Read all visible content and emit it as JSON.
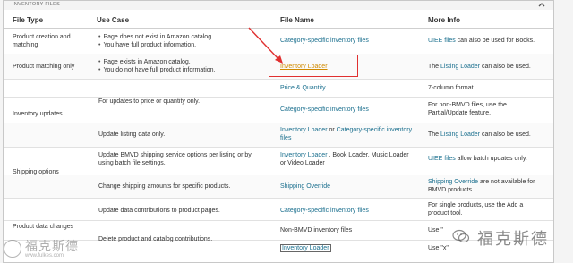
{
  "panel": {
    "title": "INVENTORY FILES"
  },
  "columns": {
    "file_type": "File Type",
    "use_case": "Use Case",
    "file_name": "File Name",
    "more_info": "More Info"
  },
  "rows": {
    "r1": {
      "file_type_1": "Product creation and",
      "file_type_2": "matching",
      "use_case_1": "Page does not exist in Amazon catalog.",
      "use_case_2": "You have full product information.",
      "file_name": "Category-specific inventory files",
      "more_info_link": "UIEE files",
      "more_info_text": " can also be used for Books."
    },
    "r2": {
      "file_type": "Product matching only",
      "use_case_1": "Page exists in Amazon catalog.",
      "use_case_2": "You do not have full product information.",
      "file_name": "Inventory Loader",
      "more_info_pre": "The ",
      "more_info_link": "Listing Loader",
      "more_info_post": " can also be used."
    },
    "r3": {
      "file_name": "Price & Quantity",
      "more_info": "7-column format"
    },
    "r4": {
      "file_type": "Inventory updates",
      "use_case": "For updates to price or quantity only.",
      "file_name": "Category-specific inventory files",
      "more_info_1": "For non-BMVD files, use the",
      "more_info_2": "Partial/Update feature."
    },
    "r5": {
      "use_case": "Update listing data only.",
      "file_name_link1": "Inventory Loader",
      "file_name_or": " or ",
      "file_name_link2_a": "Category-specific inventory",
      "file_name_link2_b": "files",
      "more_info_pre": "The ",
      "more_info_link": "Listing Loader",
      "more_info_post": " can also be used."
    },
    "r6": {
      "file_type": "Shipping options",
      "use_case_1": "Update BMVD shipping service options per listing or by",
      "use_case_2": "using batch file settings.",
      "file_name_link1": "Inventory Loader",
      "file_name_mid": " , Book Loader, Music Loader",
      "file_name_2": "or Video Loader",
      "more_info_link": "UIEE files",
      "more_info_text": " allow batch updates only."
    },
    "r7": {
      "use_case": "Change shipping amounts for specific products.",
      "file_name": "Shipping Override",
      "more_info_link": "Shipping Override",
      "more_info_text": " are not available for",
      "more_info_2": "BMVD products."
    },
    "r8": {
      "use_case": "Update data contributions to product pages.",
      "file_name": "Category-specific inventory files",
      "more_info_1": "For single products, use the Add a",
      "more_info_2": "product tool."
    },
    "r9": {
      "file_type": "Product data changes",
      "use_case": "Delete product and catalog contributions.",
      "file_name": "Non-BMVD inventory files",
      "more_info": "Use \""
    },
    "r10": {
      "file_name": "Inventory Loader",
      "more_info": "Use \"x\""
    }
  },
  "watermarks": {
    "left_text": "福克斯德",
    "left_sub": "www.fulkes.com",
    "right_text": "福克斯德"
  },
  "colors": {
    "link": "#1a6f8e",
    "highlight": "#e03030",
    "highlight_link": "#d08a00"
  }
}
